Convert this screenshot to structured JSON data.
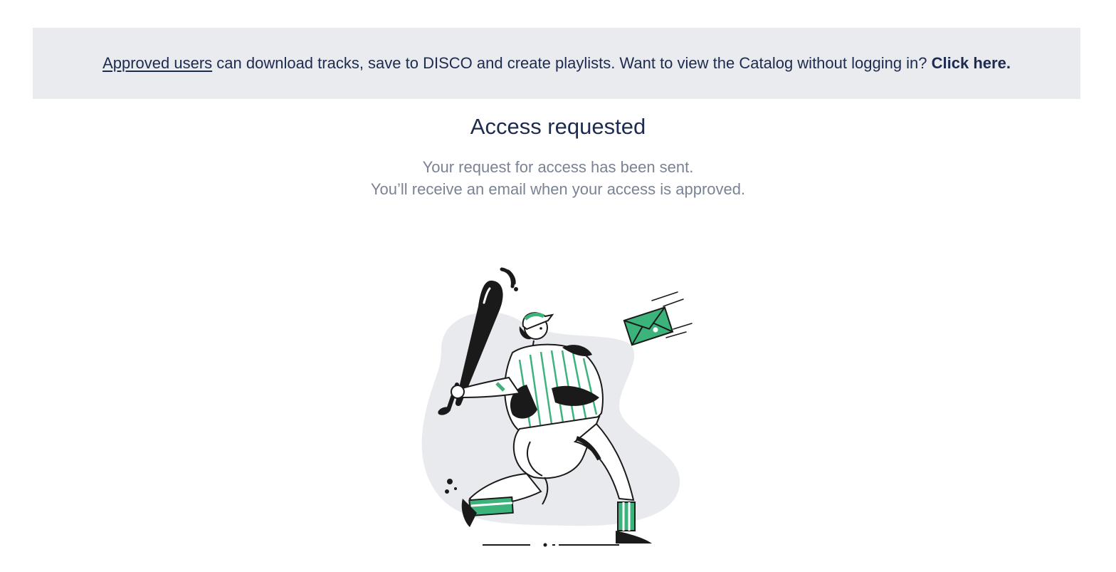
{
  "banner": {
    "link_text": "Approved users",
    "body_text": " can download tracks, save to DISCO and create playlists. Want to view the Catalog without logging in? ",
    "cta_text": "Click here."
  },
  "main": {
    "title": "Access requested",
    "message_line1": "Your request for access has been sent.",
    "message_line2": "You’ll receive an email when your access is approved."
  },
  "illustration": {
    "name": "baseball-player-hitting-envelope",
    "colors": {
      "accent": "#3cb37a",
      "ink": "#1a1a1a",
      "blob": "#e8eaee"
    }
  }
}
